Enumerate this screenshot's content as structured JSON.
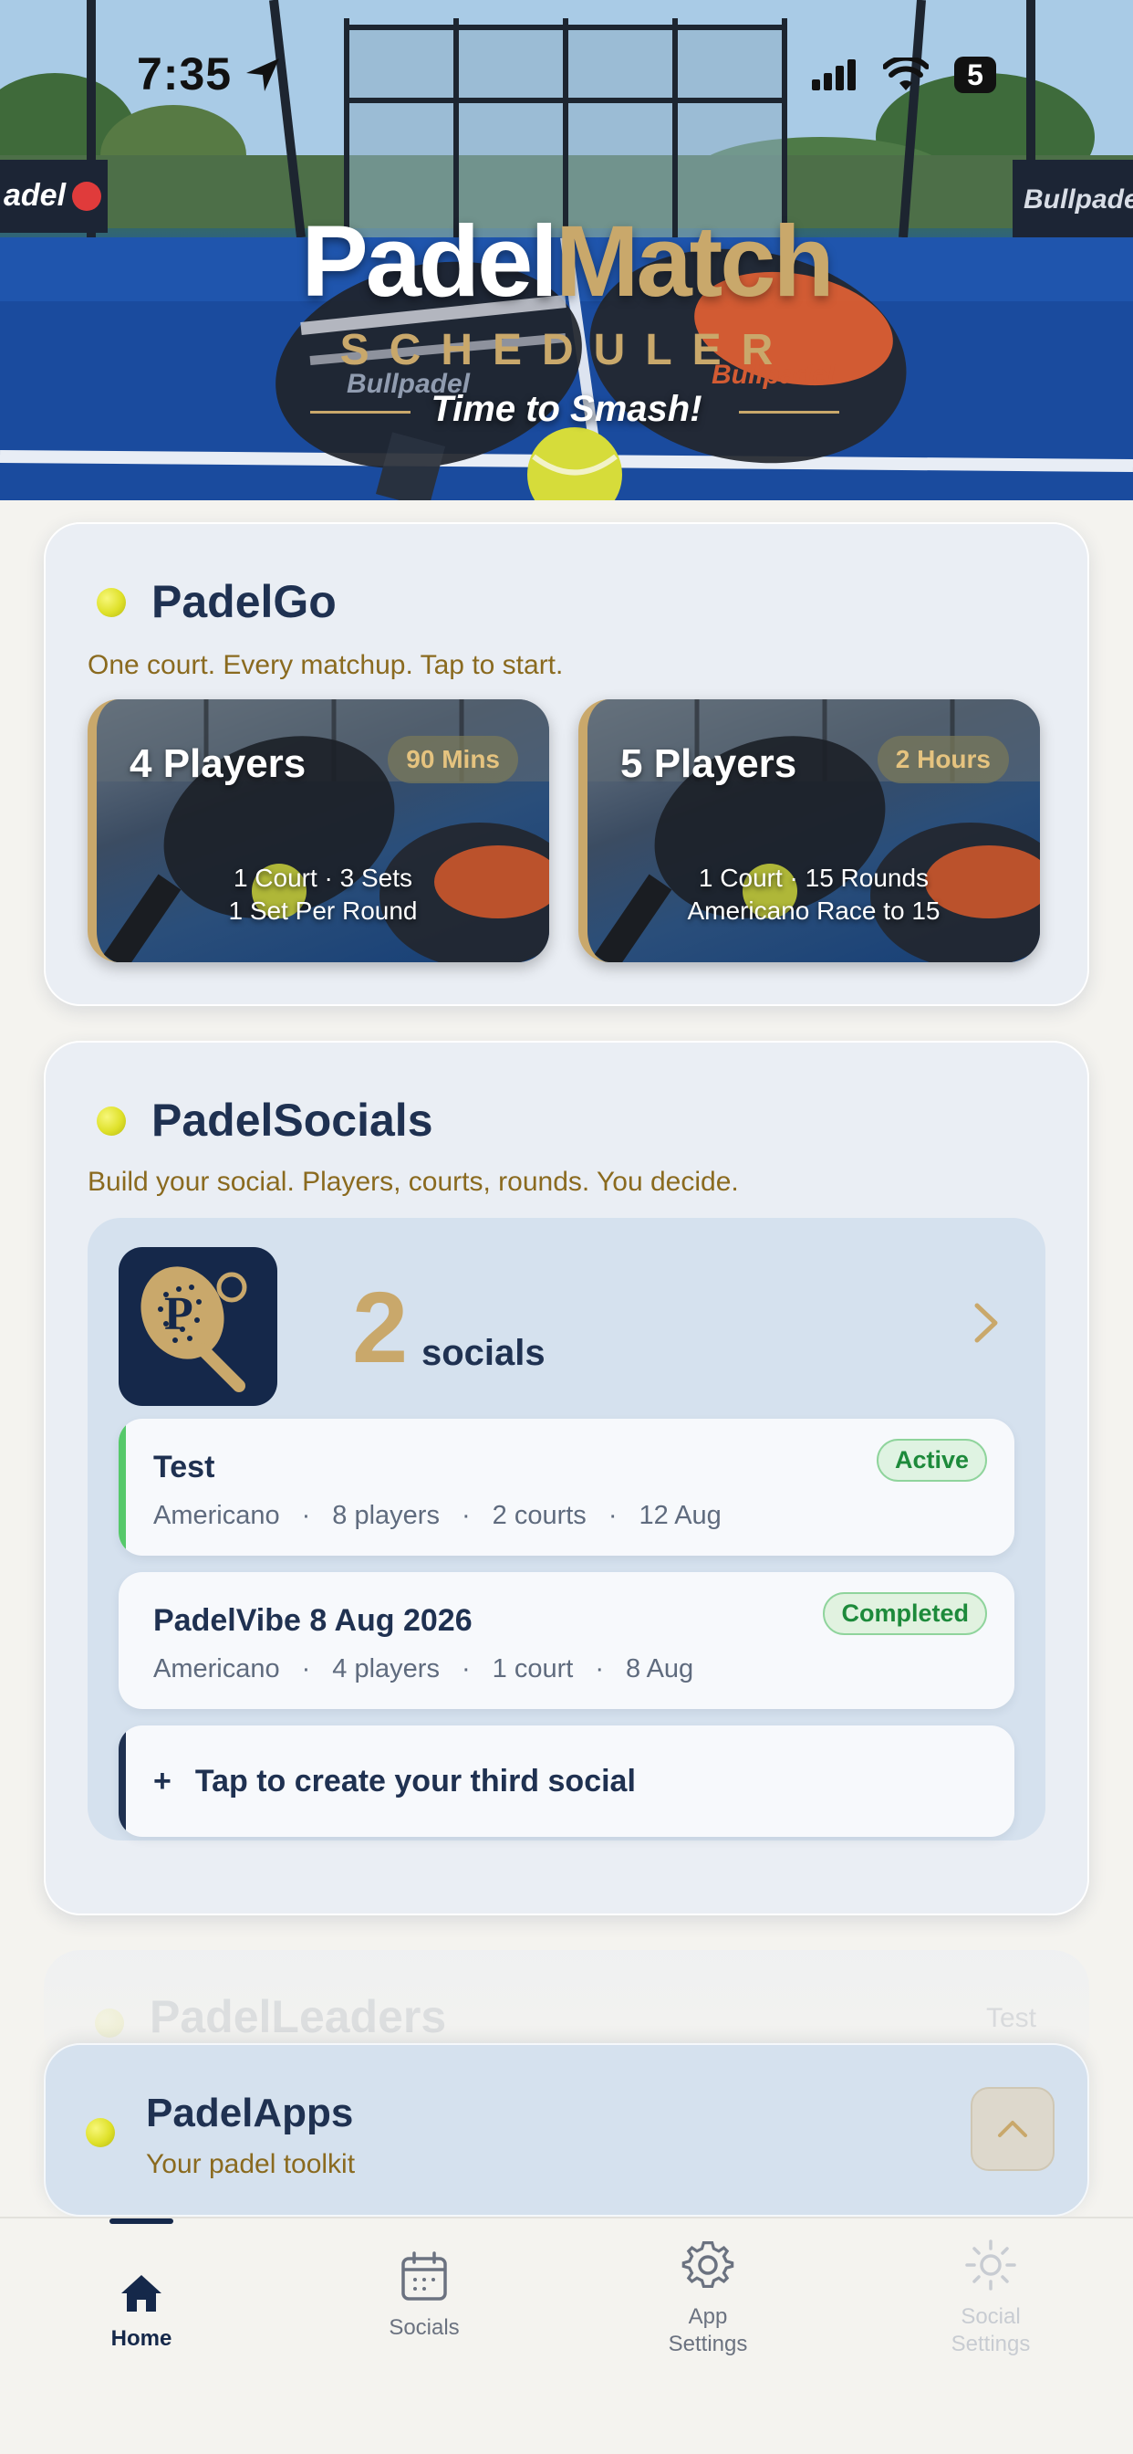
{
  "status_bar": {
    "time": "7:35",
    "battery": "5"
  },
  "hero": {
    "brand_white": "Padel",
    "brand_gold": "Match",
    "brand_sub": "SCHEDULER",
    "tagline": "Time to Smash!",
    "banner_text_left": "adel",
    "banner_text_right": "Bullpade",
    "paddle_text": "Bullpadel"
  },
  "padelgo": {
    "title": "PadelGo",
    "subtitle": "One court. Every matchup. Tap to start.",
    "tiles": [
      {
        "title": "4 Players",
        "badge": "90 Mins",
        "line1": "1 Court · 3 Sets",
        "line2": "1 Set Per Round"
      },
      {
        "title": "5 Players",
        "badge": "2 Hours",
        "line1": "1 Court · 15 Rounds",
        "line2": "Americano Race to 15"
      }
    ]
  },
  "padelsocials": {
    "title": "PadelSocials",
    "subtitle": "Build your social. Players, courts, rounds. You decide.",
    "count": "2",
    "count_label": "socials",
    "items": [
      {
        "name": "Test",
        "status": "Active",
        "meta": [
          "Americano",
          "8 players",
          "2 courts",
          "12 Aug"
        ]
      },
      {
        "name": "PadelVibe 8 Aug 2026",
        "status": "Completed",
        "meta": [
          "Americano",
          "4 players",
          "1 court",
          "8 Aug"
        ]
      }
    ],
    "separator": "·",
    "create_plus": "+",
    "create_label": "Tap to create your third social"
  },
  "padelleaders": {
    "title": "PadelLeaders",
    "peek": "Test"
  },
  "padelapps": {
    "title": "PadelApps",
    "subtitle": "Your padel toolkit"
  },
  "tabbar": {
    "tabs": [
      {
        "label": "Home",
        "icon": "home-icon",
        "active": true
      },
      {
        "label": "Socials",
        "icon": "calendar-icon",
        "active": false
      },
      {
        "label": "App\nSettings",
        "icon": "gear-icon",
        "active": false
      },
      {
        "label": "Social\nSettings",
        "icon": "sun-gear-icon",
        "active": false
      }
    ]
  },
  "colors": {
    "navy": "#1f3151",
    "gold": "#c9a86b",
    "subtitle_brown": "#8a6a1f",
    "active_green": "#1d8a3b",
    "card_bg": "#eaeef4",
    "panel_bg": "#d5e1ee"
  }
}
